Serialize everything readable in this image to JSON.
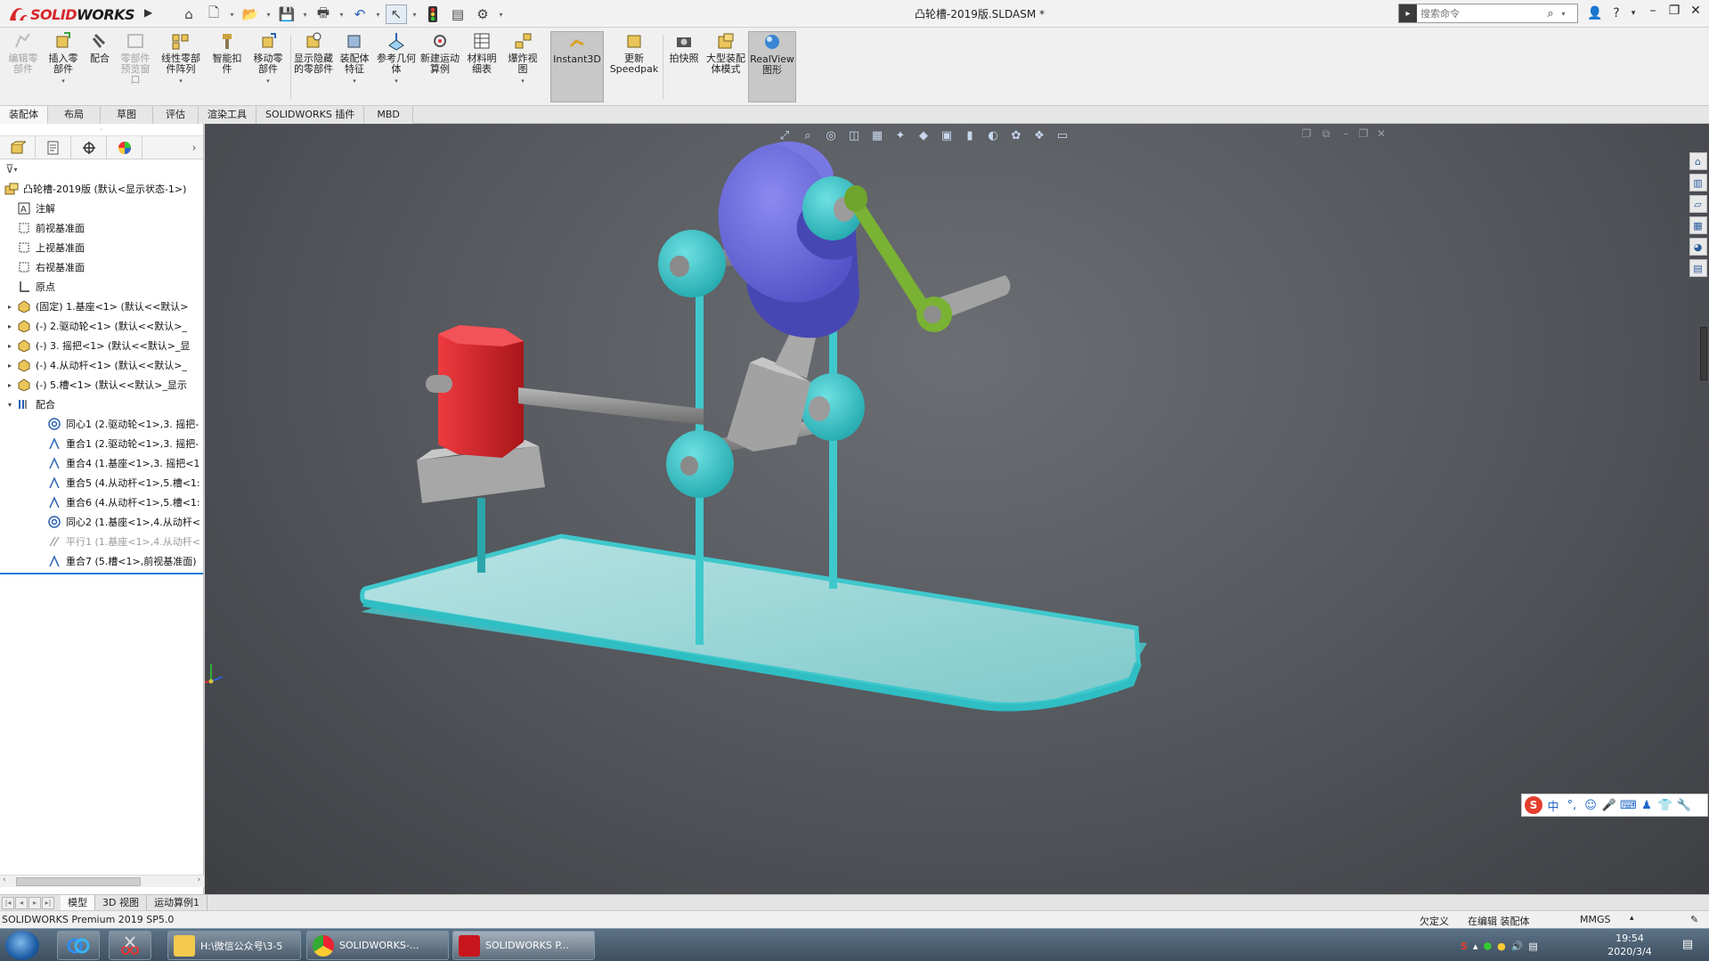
{
  "app": {
    "brand_prefix": "3S",
    "brand_name_a": "SOLID",
    "brand_name_b": "WORKS",
    "document_title": "凸轮槽-2019版.SLDASM *"
  },
  "search": {
    "placeholder": "搜索命令"
  },
  "quick_access": [
    "home-icon",
    "new-document-icon",
    "open-icon",
    "save-icon",
    "print-icon",
    "undo-icon",
    "select-icon",
    "traffic-light-icon",
    "file-properties-icon",
    "options-icon"
  ],
  "command_manager": [
    {
      "label": "编辑零部件",
      "disabled": true
    },
    {
      "label": "插入零部件",
      "disabled": false
    },
    {
      "label": "配合",
      "disabled": false
    },
    {
      "label": "零部件预览窗口",
      "disabled": true
    },
    {
      "label": "线性零部件阵列",
      "disabled": false
    },
    {
      "label": "智能扣件",
      "disabled": false
    },
    {
      "label": "移动零部件",
      "disabled": false
    },
    {
      "label": "显示隐藏的零部件",
      "disabled": false
    },
    {
      "label": "装配体特征",
      "disabled": false
    },
    {
      "label": "参考几何体",
      "disabled": false
    },
    {
      "label": "新建运动算例",
      "disabled": false
    },
    {
      "label": "材料明细表",
      "disabled": false
    },
    {
      "label": "爆炸视图",
      "disabled": false
    },
    {
      "label": "Instant3D",
      "disabled": false,
      "active": true
    },
    {
      "label": "更新Speedpak",
      "disabled": false
    },
    {
      "label": "拍快照",
      "disabled": false
    },
    {
      "label": "大型装配体模式",
      "disabled": false
    },
    {
      "label": "RealView图形",
      "disabled": false,
      "active": true
    }
  ],
  "tabs": [
    "装配体",
    "布局",
    "草图",
    "评估",
    "渲染工具",
    "SOLIDWORKS 插件",
    "MBD"
  ],
  "tree": {
    "root": "凸轮槽-2019版  (默认<显示状态-1>)",
    "items": [
      {
        "label": "注解",
        "icon": "annotation-icon",
        "level": 1,
        "expand": ""
      },
      {
        "label": "前视基准面",
        "icon": "plane-icon",
        "level": 1,
        "expand": ""
      },
      {
        "label": "上视基准面",
        "icon": "plane-icon",
        "level": 1,
        "expand": ""
      },
      {
        "label": "右视基准面",
        "icon": "plane-icon",
        "level": 1,
        "expand": ""
      },
      {
        "label": "原点",
        "icon": "origin-icon",
        "level": 1,
        "expand": ""
      },
      {
        "label": "(固定) 1.基座<1> (默认<<默认>",
        "icon": "part-icon",
        "level": 1,
        "expand": "▸"
      },
      {
        "label": "(-) 2.驱动轮<1> (默认<<默认>_",
        "icon": "part-icon",
        "level": 1,
        "expand": "▸"
      },
      {
        "label": "(-) 3. 摇把<1> (默认<<默认>_显",
        "icon": "part-icon",
        "level": 1,
        "expand": "▸"
      },
      {
        "label": "(-) 4.从动杆<1> (默认<<默认>_",
        "icon": "part-icon",
        "level": 1,
        "expand": "▸"
      },
      {
        "label": "(-) 5.槽<1> (默认<<默认>_显示",
        "icon": "part-icon",
        "level": 1,
        "expand": "▸"
      },
      {
        "label": "配合",
        "icon": "mates-folder-icon",
        "level": 1,
        "expand": "▾"
      },
      {
        "label": "同心1 (2.驱动轮<1>,3. 摇把-",
        "icon": "concentric-icon",
        "level": 2,
        "expand": ""
      },
      {
        "label": "重合1 (2.驱动轮<1>,3. 摇把-",
        "icon": "coincident-icon",
        "level": 2,
        "expand": ""
      },
      {
        "label": "重合4 (1.基座<1>,3. 摇把<1",
        "icon": "coincident-icon",
        "level": 2,
        "expand": ""
      },
      {
        "label": "重合5 (4.从动杆<1>,5.槽<1:",
        "icon": "coincident-icon",
        "level": 2,
        "expand": ""
      },
      {
        "label": "重合6 (4.从动杆<1>,5.槽<1:",
        "icon": "coincident-icon",
        "level": 2,
        "expand": ""
      },
      {
        "label": "同心2 (1.基座<1>,4.从动杆<",
        "icon": "concentric-icon",
        "level": 2,
        "expand": ""
      },
      {
        "label": "平行1 (1.基座<1>,4.从动杆<",
        "icon": "parallel-icon",
        "level": 2,
        "expand": "",
        "dim": true
      },
      {
        "label": "重合7 (5.槽<1>,前视基准面)",
        "icon": "coincident-icon",
        "level": 2,
        "expand": ""
      }
    ]
  },
  "bottom_tabs": [
    "模型",
    "3D 视图",
    "运动算例1"
  ],
  "status": {
    "product": "SOLIDWORKS Premium 2019 SP5.0",
    "definition": "欠定义",
    "editing": "在编辑 装配体",
    "units": "MMGS"
  },
  "taskbar": {
    "tasks": [
      {
        "label": "H:\\微信公众号\\3-5"
      },
      {
        "label": "SOLIDWORKS-..."
      },
      {
        "label": "SOLIDWORKS P..."
      }
    ],
    "time": "19:54",
    "date": "2020/3/4"
  },
  "colors": {
    "accent": "#d8262a",
    "cam": "#6d6de0",
    "frame": "#3fc8cc",
    "base": "#8fd6d8",
    "red_block": "#d21f24",
    "link": "#7ab234"
  }
}
